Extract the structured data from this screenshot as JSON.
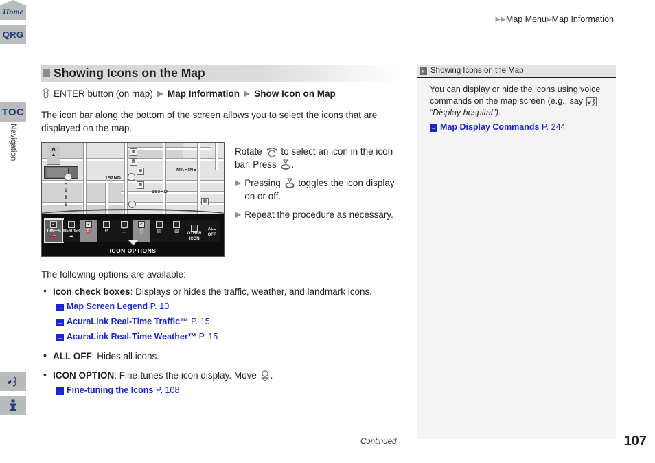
{
  "sidebar": {
    "qrg_label": "QRG",
    "toc_label": "TOC",
    "chapter_label": "Navigation",
    "voice_icon": "voice-command-icon",
    "info_icon": "information-icon",
    "home_label": "Home"
  },
  "header": {
    "breadcrumb": "Map Menu",
    "breadcrumb2": "Map Information"
  },
  "main": {
    "section_title": "Showing Icons on the Map",
    "nav_path": {
      "knob_icon": "enter-knob-icon",
      "step1": "ENTER button (on map)",
      "step2": "Map Information",
      "step3": "Show Icon on Map"
    },
    "intro": "The icon bar along the bottom of the screen allows you to select the icons that are displayed on the map.",
    "steps": {
      "line1_a": "Rotate",
      "line1_b": "to select an icon in the icon bar. Press",
      "line1_c": ".",
      "sub1_a": "Pressing",
      "sub1_b": "toggles the icon display on or off.",
      "sub2": "Repeat the procedure as necessary."
    },
    "options_intro": "The following options are available:",
    "options": [
      {
        "term": "Icon check boxes",
        "desc": ": Displays or hides the traffic, weather, and landmark icons.",
        "refs": [
          {
            "title": "Map Screen Legend",
            "page": "P. 10"
          },
          {
            "title": "AcuraLink Real-Time Traffic™",
            "page": "P. 15"
          },
          {
            "title": "AcuraLink Real-Time Weather™",
            "page": "P. 15"
          }
        ]
      },
      {
        "term": "ALL OFF",
        "desc": ": Hides all icons.",
        "refs": []
      },
      {
        "term": "ICON OPTION",
        "desc": ": Fine-tunes the icon display. Move",
        "desc_tail": ".",
        "refs": [
          {
            "title": "Fine-tuning the Icons",
            "page": "P. 108"
          }
        ]
      }
    ]
  },
  "figure": {
    "compass_letter": "N",
    "street_labels": [
      "MARINE",
      "152ND",
      "153RD",
      "H.A.A.S"
    ],
    "iconbar": {
      "cells": [
        {
          "label": "TRAFFIC",
          "checked": true,
          "state": "selected",
          "glyph": "▬"
        },
        {
          "label": "WEATHER",
          "checked": false,
          "state": "normal",
          "glyph": "☁"
        },
        {
          "label": "",
          "checked": true,
          "state": "lit",
          "glyph": "⛽"
        },
        {
          "label": "",
          "checked": false,
          "state": "normal",
          "glyph": "P"
        },
        {
          "label": "",
          "checked": false,
          "state": "normal",
          "glyph": "ⓘ"
        },
        {
          "label": "",
          "checked": true,
          "state": "lit",
          "glyph": "☴"
        },
        {
          "label": "",
          "checked": false,
          "state": "normal",
          "glyph": "☲"
        },
        {
          "label": "",
          "checked": false,
          "state": "normal",
          "glyph": "ATM"
        }
      ],
      "other_icon": "OTHER ICON",
      "all_off": "ALL OFF",
      "caption": "ICON OPTIONS"
    }
  },
  "right_panel": {
    "title": "Showing Icons on the Map",
    "body_a": "You can display or hide the icons using voice commands on the map screen (e.g., say",
    "body_b": "“Display hospital”).",
    "ref": {
      "title": "Map Display Commands",
      "page": "P. 244"
    }
  },
  "footer": {
    "continued": "Continued",
    "page_number": "107"
  }
}
